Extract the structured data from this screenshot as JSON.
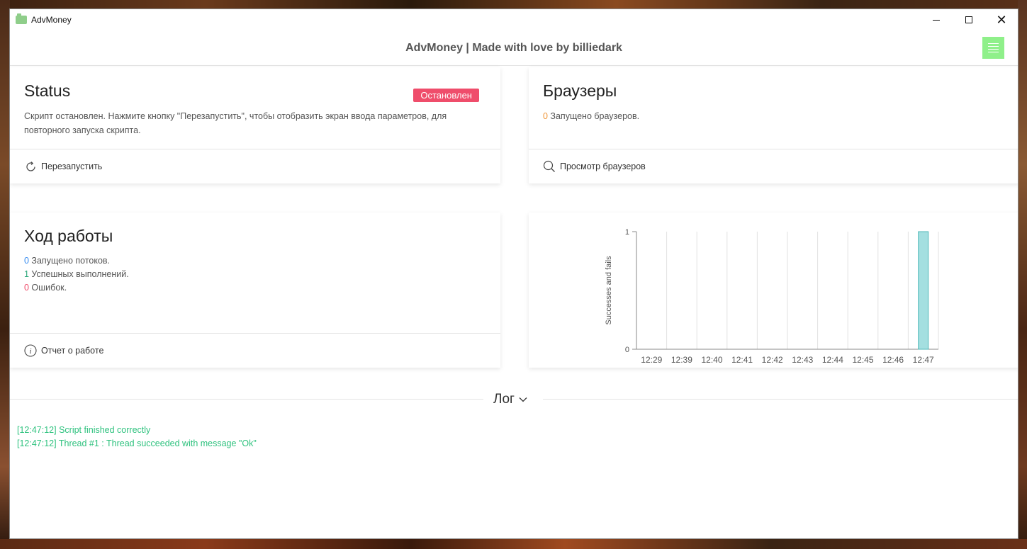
{
  "window": {
    "title": "AdvMoney"
  },
  "header": {
    "title": "AdvMoney | Made with love by billiedark"
  },
  "status_card": {
    "title": "Status",
    "badge": "Остановлен",
    "badge_color": "#ef4d6b",
    "description": "Скрипт остановлен. Нажмите кнопку \"Перезапустить\", чтобы отобразить экран ввода параметров, для повторного запуска скрипта.",
    "action_label": "Перезапустить"
  },
  "browsers_card": {
    "title": "Браузеры",
    "count": "0",
    "count_label": " Запущено браузеров.",
    "action_label": "Просмотр браузеров"
  },
  "progress_card": {
    "title": "Ход работы",
    "threads": {
      "count": "0",
      "label": " Запущено потоков."
    },
    "success": {
      "count": "1",
      "label": " Успешных выполнений."
    },
    "errors": {
      "count": "0",
      "label": " Ошибок."
    },
    "action_label": "Отчет о работе"
  },
  "chart_data": {
    "type": "bar",
    "ylabel": "Successes and fails",
    "categories": [
      "12:29",
      "12:39",
      "12:40",
      "12:41",
      "12:42",
      "12:43",
      "12:44",
      "12:45",
      "12:46",
      "12:47"
    ],
    "values": [
      0,
      0,
      0,
      0,
      0,
      0,
      0,
      0,
      0,
      1
    ],
    "ylim": [
      0,
      1
    ],
    "yticks": [
      "0",
      "1"
    ],
    "bar_color": "#a4dfe0",
    "bar_border_color": "#4fb8b8"
  },
  "log": {
    "title": "Лог",
    "lines": [
      "[12:47:12] Script finished correctly",
      "[12:47:12] Thread #1 : Thread succeeded with message \"Ok\""
    ]
  },
  "colors": {
    "menu_button": "#8ff08a",
    "log_text": "#2ec27e"
  }
}
